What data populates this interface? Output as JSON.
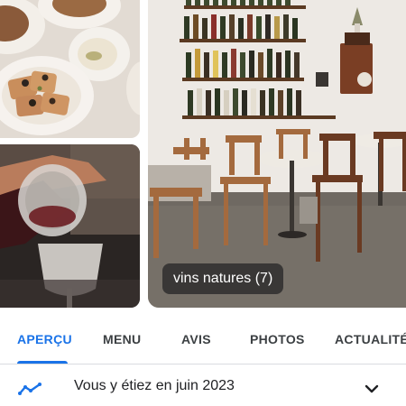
{
  "gallery": {
    "photo_badge": "vins natures (7)",
    "photos": [
      {
        "icon": "food-plates-photo"
      },
      {
        "icon": "wine-pour-photo"
      },
      {
        "icon": "wine-bar-interior-photo"
      }
    ]
  },
  "tabs": {
    "active_index": 0,
    "items": [
      {
        "label": "APERÇU"
      },
      {
        "label": "MENU"
      },
      {
        "label": "AVIS"
      },
      {
        "label": "PHOTOS"
      },
      {
        "label": "ACTUALITÉ"
      }
    ]
  },
  "visited": {
    "text": "Vous y étiez en juin 2023",
    "icon": "timeline-icon",
    "expand_icon": "chevron-down-icon"
  },
  "colors": {
    "accent": "#1a73e8",
    "text": "#202124",
    "tab_text": "#3c4043",
    "divider": "#dadce0"
  }
}
